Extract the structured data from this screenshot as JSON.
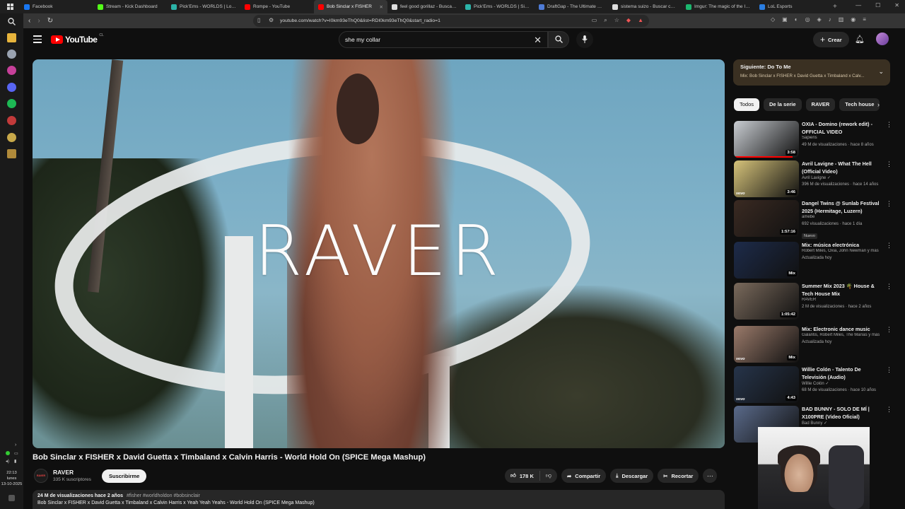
{
  "browser": {
    "tabs": [
      {
        "title": "Facebook",
        "color": "#1877f2",
        "active": false
      },
      {
        "title": "Stream - Kick Dashboard",
        "color": "#53fc18",
        "active": false
      },
      {
        "title": "Pick'Ems - WORLDS | LoL Esp",
        "color": "#2bb3a8",
        "active": false
      },
      {
        "title": "Rompe - YouTube",
        "color": "#ff0000",
        "active": false
      },
      {
        "title": "Bob Sinclar x FISHER",
        "color": "#ff0000",
        "active": true
      },
      {
        "title": "feel good gorillaz - Buscar co",
        "color": "#dddddd",
        "active": false
      },
      {
        "title": "Pick'Ems - WORLDS | Sistem",
        "color": "#2bb3a8",
        "active": false
      },
      {
        "title": "DraftGap - The Ultimate Leag",
        "color": "#4e7bd6",
        "active": false
      },
      {
        "title": "sistema suizo - Buscar con G",
        "color": "#dddddd",
        "active": false
      },
      {
        "title": "Imgur: The magic of the Inte",
        "color": "#1bb76e",
        "active": false
      },
      {
        "title": "LoL Esports",
        "color": "#2a7de1",
        "active": false
      }
    ],
    "new_tab": "+",
    "url": "youtube.com/watch?v=I0km93eThQ0&list=RDI0km93eThQ0&start_radio=1"
  },
  "sidebar_clock": {
    "time": "22:13",
    "day": "lunes",
    "date": "13-10-2025"
  },
  "youtube": {
    "logo_text": "YouTube",
    "country": "CL",
    "search_value": "she my collar",
    "create_label": "Crear"
  },
  "video": {
    "overlay_brand": "RAVER",
    "title": "Bob Sinclar x FISHER x David Guetta x Timbaland x Calvin Harris - World Hold On (SPICE Mega Mashup)",
    "channel": "RAVER",
    "subscribers": "335 K suscriptores",
    "subscribe_label": "Suscribirme",
    "likes": "178 K",
    "share_label": "Compartir",
    "download_label": "Descargar",
    "clip_label": "Recortar",
    "views_age": "24 M de visualizaciones  hace 2 años",
    "hashtags": "#fisher #worldholdon #bobsinclair",
    "description_line": "Bob Sinclar x FISHER x David Guetta x Timbaland x Calvin Harris x Yeah Yeah Yeahs - World Hold On (SPICE Mega Mashup)"
  },
  "up_next": {
    "label": "Siguiente: Do To Me",
    "sub": "Mix: Bob Sinclar x FISHER x David Guetta x Timbaland x Calv..."
  },
  "chips": [
    "Todos",
    "De la serie",
    "RAVER",
    "Tech house"
  ],
  "recommendations": [
    {
      "title": "OXIA - Domino (rework edit) - OFFICIAL VIDEO",
      "channel": "Sapiens",
      "meta": "49 M de visualizaciones · hace 8 años",
      "duration": "3:58",
      "progress": 0.9,
      "thumb_color": "#c9cdd2",
      "vevo": false
    },
    {
      "title": "Avril Lavigne - What The Hell (Official Video)",
      "channel": "Avril Lavigne ✓",
      "meta": "396 M de visualizaciones · hace 14 años",
      "duration": "3:46",
      "progress": 0,
      "thumb_color": "#d6c37a",
      "vevo": true
    },
    {
      "title": "Dangel Twins @ Sunlab Festival 2025 (Hermitage, Luzern)",
      "channel": "amebe",
      "meta": "692 visualizaciones · hace 1 día",
      "duration": "1:57:16",
      "progress": 0,
      "thumb_color": "#3a2a22",
      "vevo": false,
      "badge": "Nuevo"
    },
    {
      "title": "Mix: música electrónica",
      "channel": "Robert Miles, Oxia, John Newman y más",
      "meta": "Actualizada hoy",
      "duration": "Mix",
      "progress": 0,
      "thumb_color": "#1d2b4a",
      "vevo": false
    },
    {
      "title": "Summer Mix 2023 🌴 House & Tech House Mix",
      "channel": "RAVER",
      "meta": "2 M de visualizaciones · hace 2 años",
      "duration": "1:05:42",
      "progress": 0,
      "thumb_color": "#7a6a5c",
      "vevo": false
    },
    {
      "title": "Mix: Electronic dance music",
      "channel": "Galantis, Robert Miles, The Marías y más",
      "meta": "Actualizada hoy",
      "duration": "Mix",
      "progress": 0,
      "thumb_color": "#9a7a6a",
      "vevo": true
    },
    {
      "title": "Willie Colón - Talento De Televisión (Audio)",
      "channel": "Willie Colón ✓",
      "meta": "68 M de visualizaciones · hace 10 años",
      "duration": "4:43",
      "progress": 0,
      "thumb_color": "#26344a",
      "vevo": true
    },
    {
      "title": "BAD BUNNY - SOLO DE MÍ | X100PRE (Video Oficial)",
      "channel": "Bad Bunny ✓",
      "meta": "",
      "duration": "",
      "progress": 0,
      "thumb_color": "#5a6a8a",
      "vevo": false
    }
  ]
}
